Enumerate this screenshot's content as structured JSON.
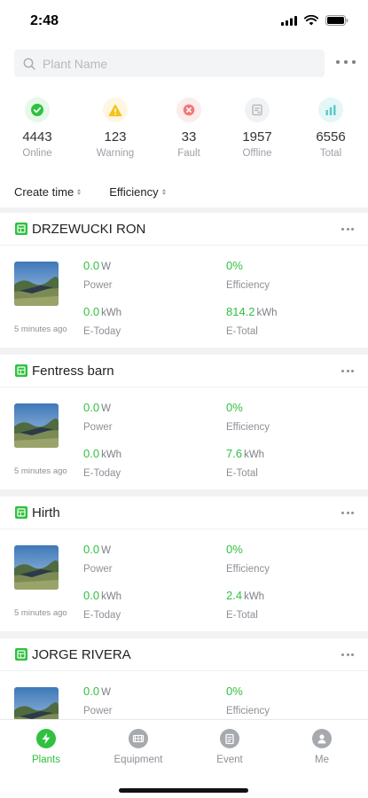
{
  "status_bar": {
    "time": "2:48"
  },
  "search": {
    "placeholder": "Plant Name"
  },
  "stats": [
    {
      "value": "4443",
      "label": "Online",
      "icon": "check-circle-icon",
      "color": "#2fc13f"
    },
    {
      "value": "123",
      "label": "Warning",
      "icon": "warning-icon",
      "color": "#f6c21c"
    },
    {
      "value": "33",
      "label": "Fault",
      "icon": "fault-x-icon",
      "color": "#f2787a"
    },
    {
      "value": "1957",
      "label": "Offline",
      "icon": "offline-icon",
      "color": "#b9bcc1"
    },
    {
      "value": "6556",
      "label": "Total",
      "icon": "bar-chart-icon",
      "color": "#5ac8c8"
    }
  ],
  "sort": {
    "create_time": "Create time",
    "efficiency": "Efficiency"
  },
  "metric_labels": {
    "power": "Power",
    "efficiency": "Efficiency",
    "e_today": "E-Today",
    "e_total": "E-Total"
  },
  "units": {
    "w": "W",
    "kwh": "kWh"
  },
  "plants": [
    {
      "name": "DRZEWUCKI RON",
      "power": "0.0",
      "efficiency": "0%",
      "e_today": "0.0",
      "e_total": "814.2",
      "updated": "5 minutes ago"
    },
    {
      "name": "Fentress barn",
      "power": "0.0",
      "efficiency": "0%",
      "e_today": "0.0",
      "e_total": "7.6",
      "updated": "5 minutes ago"
    },
    {
      "name": "Hirth",
      "power": "0.0",
      "efficiency": "0%",
      "e_today": "0.0",
      "e_total": "2.4",
      "updated": "5 minutes ago"
    },
    {
      "name": "JORGE RIVERA",
      "power": "0.0",
      "efficiency": "0%",
      "e_today": "",
      "e_total": "",
      "updated": ""
    }
  ],
  "tabs": [
    {
      "label": "Plants",
      "icon": "plants-bolt-icon",
      "active": true
    },
    {
      "label": "Equipment",
      "icon": "equipment-icon",
      "active": false
    },
    {
      "label": "Event",
      "icon": "event-icon",
      "active": false
    },
    {
      "label": "Me",
      "icon": "user-icon",
      "active": false
    }
  ],
  "colors": {
    "accent": "#2fc13f",
    "muted": "#8d9096"
  }
}
